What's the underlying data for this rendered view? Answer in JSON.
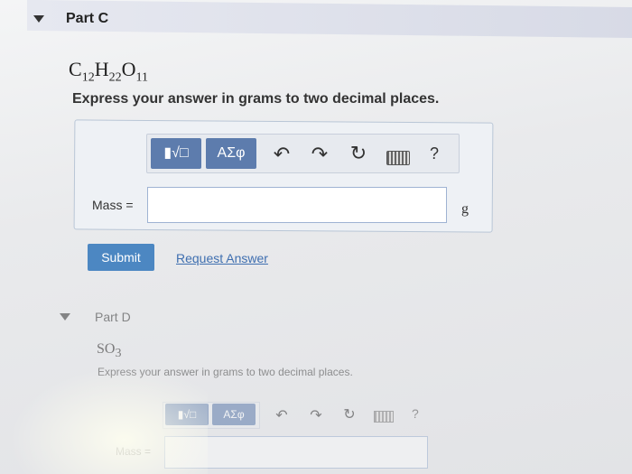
{
  "part_c": {
    "header": "Part C",
    "formula": {
      "c": "C",
      "c_n": "12",
      "h": "H",
      "h_n": "22",
      "o": "O",
      "o_n": "11"
    },
    "instruction": "Express your answer in grams to two decimal places.",
    "toolbar": {
      "template_btn": "▮√□",
      "greek_btn": "ΑΣφ",
      "undo_icon": "undo-icon",
      "redo_icon": "redo-icon",
      "reset_icon": "reset-icon",
      "keyboard_icon": "keyboard-icon",
      "help_label": "?"
    },
    "mass_label": "Mass =",
    "mass_value": "",
    "unit": "g",
    "submit_label": "Submit",
    "request_label": "Request Answer"
  },
  "part_d": {
    "header": "Part D",
    "formula": {
      "s": "SO",
      "n": "3"
    },
    "instruction": "Express your answer in grams to two decimal places.",
    "toolbar": {
      "template_btn": "▮√□",
      "greek_btn": "ΑΣφ",
      "help_label": "?"
    },
    "mass_label": "Mass ="
  },
  "colors": {
    "accent": "#5d7cad",
    "submit": "#4c87c2",
    "link": "#3f6fb0"
  }
}
